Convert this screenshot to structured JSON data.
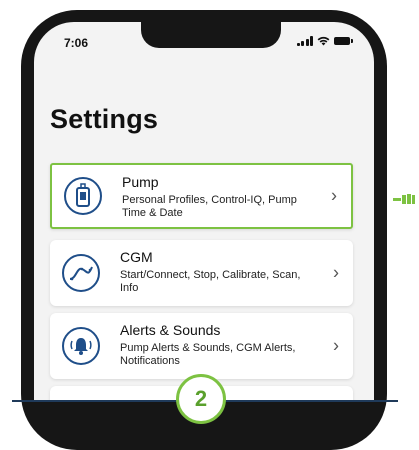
{
  "status_bar": {
    "time": "7:06"
  },
  "header": {
    "title": "Settings"
  },
  "menu": [
    {
      "id": "pump",
      "title": "Pump",
      "description": "Personal Profiles, Control-IQ, Pump Time & Date",
      "icon": "pump-icon",
      "selected": true
    },
    {
      "id": "cgm",
      "title": "CGM",
      "description": "Start/Connect, Stop, Calibrate, Scan, Info",
      "icon": "cgm-trend-icon",
      "selected": false
    },
    {
      "id": "alerts",
      "title": "Alerts & Sounds",
      "description": "Pump Alerts & Sounds, CGM Alerts, Notifications",
      "icon": "bell-icon",
      "selected": false
    }
  ],
  "step": {
    "number": "2"
  },
  "colors": {
    "highlight": "#7dc242",
    "icon_blue": "#1f4e89",
    "frame": "#161616"
  }
}
